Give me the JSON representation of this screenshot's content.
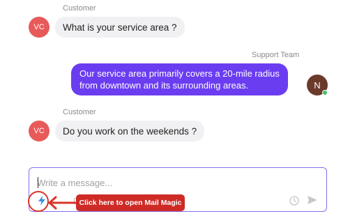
{
  "messages": [
    {
      "sender": "Customer",
      "avatar_initials": "VC",
      "text": "What is your service area ?"
    },
    {
      "sender": "Support Team",
      "avatar_initials": "N",
      "text_line1": "Our service area primarily covers a 20-mile radius",
      "text_line2": "from downtown and its surrounding areas."
    },
    {
      "sender": "Customer",
      "avatar_initials": "VC",
      "text": "Do you work on the weekends ?"
    }
  ],
  "composer": {
    "placeholder": "Write a message..."
  },
  "icons": {
    "magic": "lightning-icon",
    "schedule": "clock-icon",
    "send": "send-arrow-icon"
  },
  "annotation": {
    "callout_text": "Click here to open Mail Magic"
  },
  "colors": {
    "customer_avatar": "#e85a5a",
    "agent_bubble": "#6b3df1",
    "agent_avatar": "#6b3a2a",
    "online": "#3cc46a",
    "annotation_red": "#cf2b26",
    "composer_border": "#8a6cf0"
  }
}
